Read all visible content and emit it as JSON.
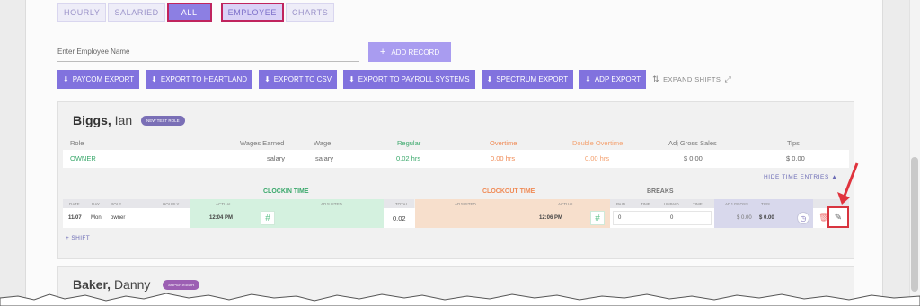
{
  "tabs": {
    "hourly": "HOURLY",
    "salaried": "SALARIED",
    "all": "ALL",
    "employee": "EMPLOYEE",
    "charts": "CHARTS"
  },
  "search": {
    "placeholder": "Enter Employee Name"
  },
  "add_record": "ADD RECORD",
  "exports": [
    "PAYCOM EXPORT",
    "EXPORT TO HEARTLAND",
    "EXPORT TO CSV",
    "EXPORT TO PAYROLL SYSTEMS",
    "SPECTRUM EXPORT",
    "ADP EXPORT"
  ],
  "expand_shifts": "EXPAND SHIFTS",
  "employees": [
    {
      "last": "Biggs,",
      "first": "Ian",
      "badge": "NEW TEST ROLE",
      "summary_headers": {
        "role": "Role",
        "wages_earned": "Wages Earned",
        "wage": "Wage",
        "regular": "Regular",
        "overtime": "Overtime",
        "double_overtime": "Double Overtime",
        "adj_gross_sales": "Adj Gross Sales",
        "tips": "Tips"
      },
      "summary": {
        "role": "OWNER",
        "wages_earned": "salary",
        "wage": "salary",
        "regular": "0.02 hrs",
        "overtime": "0.00 hrs",
        "double_overtime": "0.00 hrs",
        "adj_gross_sales": "$ 0.00",
        "tips": "$ 0.00"
      },
      "hide_time_entries": "HIDE TIME ENTRIES",
      "groups": {
        "clockin": "CLOCKIN TIME",
        "clockout": "CLOCKOUT TIME",
        "breaks": "BREAKS"
      },
      "entry_headers": {
        "date": "DATE",
        "day": "DAY",
        "role": "ROLE",
        "hourly": "HOURLY",
        "actual_in": "ACTUAL",
        "adjusted_in": "ADJUSTED",
        "total": "TOTAL",
        "adjusted_out": "ADJUSTED",
        "actual_out": "ACTUAL",
        "paid": "PAID",
        "time1": "TIME",
        "unpaid": "UNPAID",
        "time2": "TIME",
        "adj_gross": "ADJ GROSS",
        "tips": "TIPS"
      },
      "entry": {
        "date": "11/07",
        "day": "Mon",
        "role": "owner",
        "actual_in": "12:04 PM",
        "total": "0.02",
        "actual_out": "12:06 PM",
        "paid": "0",
        "unpaid": "0",
        "adj_gross": "$ 0.00",
        "tips": "$ 0.00"
      },
      "add_shift": "+ SHIFT"
    },
    {
      "last": "Baker,",
      "first": "Danny",
      "badge": "SUPERVISOR"
    }
  ]
}
